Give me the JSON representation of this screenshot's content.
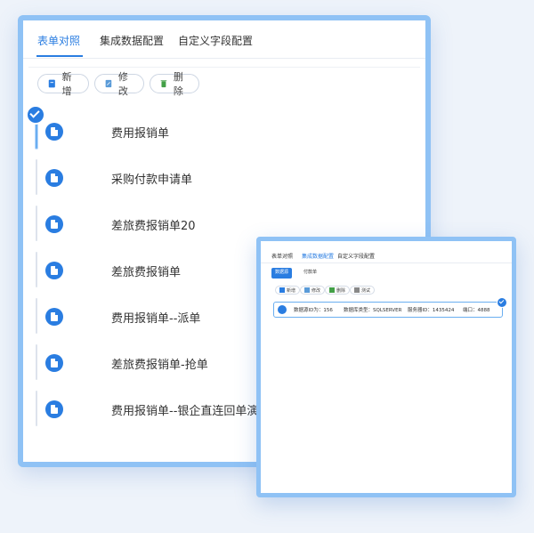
{
  "main": {
    "tabs": [
      "表单对照",
      "集成数据配置",
      "自定义字段配置"
    ],
    "toolbar": {
      "add": "新增",
      "edit": "修改",
      "delete": "删除"
    },
    "items": [
      "费用报销单",
      "采购付款申请单",
      "差旅费报销单20",
      "差旅费报销单",
      "费用报销单--派单",
      "差旅费报销单-抢单",
      "费用报销单--银企直连回单演"
    ]
  },
  "sub": {
    "tabs": [
      "表单对照",
      "集成数据配置",
      "自定义字段配置"
    ],
    "subtabs": [
      "数据源",
      "付款单"
    ],
    "toolbar": {
      "add": "新增",
      "edit": "修改",
      "delete": "删除",
      "test": "测试"
    },
    "item": {
      "source_id": "数据源ID为：156",
      "db_type": "数据库类型：SQLSERVER",
      "service_id": "服务器ID：1435424",
      "port": "端口：4888"
    }
  },
  "colors": {
    "accent": "#2a7de1",
    "frame": "#8fc2f5"
  }
}
